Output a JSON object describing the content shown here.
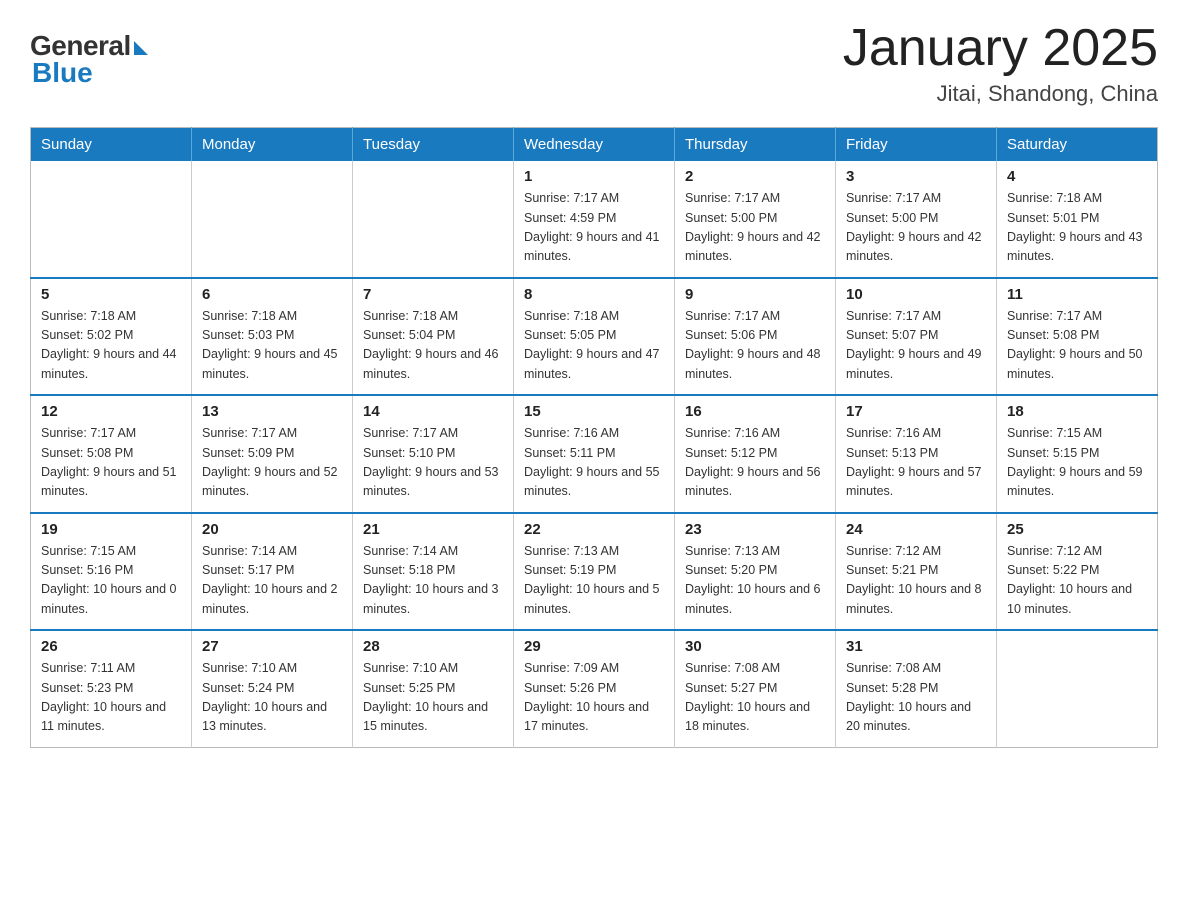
{
  "header": {
    "logo_general": "General",
    "logo_blue": "Blue",
    "month_title": "January 2025",
    "location": "Jitai, Shandong, China"
  },
  "weekdays": [
    "Sunday",
    "Monday",
    "Tuesday",
    "Wednesday",
    "Thursday",
    "Friday",
    "Saturday"
  ],
  "weeks": [
    [
      {
        "day": "",
        "info": ""
      },
      {
        "day": "",
        "info": ""
      },
      {
        "day": "",
        "info": ""
      },
      {
        "day": "1",
        "info": "Sunrise: 7:17 AM\nSunset: 4:59 PM\nDaylight: 9 hours\nand 41 minutes."
      },
      {
        "day": "2",
        "info": "Sunrise: 7:17 AM\nSunset: 5:00 PM\nDaylight: 9 hours\nand 42 minutes."
      },
      {
        "day": "3",
        "info": "Sunrise: 7:17 AM\nSunset: 5:00 PM\nDaylight: 9 hours\nand 42 minutes."
      },
      {
        "day": "4",
        "info": "Sunrise: 7:18 AM\nSunset: 5:01 PM\nDaylight: 9 hours\nand 43 minutes."
      }
    ],
    [
      {
        "day": "5",
        "info": "Sunrise: 7:18 AM\nSunset: 5:02 PM\nDaylight: 9 hours\nand 44 minutes."
      },
      {
        "day": "6",
        "info": "Sunrise: 7:18 AM\nSunset: 5:03 PM\nDaylight: 9 hours\nand 45 minutes."
      },
      {
        "day": "7",
        "info": "Sunrise: 7:18 AM\nSunset: 5:04 PM\nDaylight: 9 hours\nand 46 minutes."
      },
      {
        "day": "8",
        "info": "Sunrise: 7:18 AM\nSunset: 5:05 PM\nDaylight: 9 hours\nand 47 minutes."
      },
      {
        "day": "9",
        "info": "Sunrise: 7:17 AM\nSunset: 5:06 PM\nDaylight: 9 hours\nand 48 minutes."
      },
      {
        "day": "10",
        "info": "Sunrise: 7:17 AM\nSunset: 5:07 PM\nDaylight: 9 hours\nand 49 minutes."
      },
      {
        "day": "11",
        "info": "Sunrise: 7:17 AM\nSunset: 5:08 PM\nDaylight: 9 hours\nand 50 minutes."
      }
    ],
    [
      {
        "day": "12",
        "info": "Sunrise: 7:17 AM\nSunset: 5:08 PM\nDaylight: 9 hours\nand 51 minutes."
      },
      {
        "day": "13",
        "info": "Sunrise: 7:17 AM\nSunset: 5:09 PM\nDaylight: 9 hours\nand 52 minutes."
      },
      {
        "day": "14",
        "info": "Sunrise: 7:17 AM\nSunset: 5:10 PM\nDaylight: 9 hours\nand 53 minutes."
      },
      {
        "day": "15",
        "info": "Sunrise: 7:16 AM\nSunset: 5:11 PM\nDaylight: 9 hours\nand 55 minutes."
      },
      {
        "day": "16",
        "info": "Sunrise: 7:16 AM\nSunset: 5:12 PM\nDaylight: 9 hours\nand 56 minutes."
      },
      {
        "day": "17",
        "info": "Sunrise: 7:16 AM\nSunset: 5:13 PM\nDaylight: 9 hours\nand 57 minutes."
      },
      {
        "day": "18",
        "info": "Sunrise: 7:15 AM\nSunset: 5:15 PM\nDaylight: 9 hours\nand 59 minutes."
      }
    ],
    [
      {
        "day": "19",
        "info": "Sunrise: 7:15 AM\nSunset: 5:16 PM\nDaylight: 10 hours\nand 0 minutes."
      },
      {
        "day": "20",
        "info": "Sunrise: 7:14 AM\nSunset: 5:17 PM\nDaylight: 10 hours\nand 2 minutes."
      },
      {
        "day": "21",
        "info": "Sunrise: 7:14 AM\nSunset: 5:18 PM\nDaylight: 10 hours\nand 3 minutes."
      },
      {
        "day": "22",
        "info": "Sunrise: 7:13 AM\nSunset: 5:19 PM\nDaylight: 10 hours\nand 5 minutes."
      },
      {
        "day": "23",
        "info": "Sunrise: 7:13 AM\nSunset: 5:20 PM\nDaylight: 10 hours\nand 6 minutes."
      },
      {
        "day": "24",
        "info": "Sunrise: 7:12 AM\nSunset: 5:21 PM\nDaylight: 10 hours\nand 8 minutes."
      },
      {
        "day": "25",
        "info": "Sunrise: 7:12 AM\nSunset: 5:22 PM\nDaylight: 10 hours\nand 10 minutes."
      }
    ],
    [
      {
        "day": "26",
        "info": "Sunrise: 7:11 AM\nSunset: 5:23 PM\nDaylight: 10 hours\nand 11 minutes."
      },
      {
        "day": "27",
        "info": "Sunrise: 7:10 AM\nSunset: 5:24 PM\nDaylight: 10 hours\nand 13 minutes."
      },
      {
        "day": "28",
        "info": "Sunrise: 7:10 AM\nSunset: 5:25 PM\nDaylight: 10 hours\nand 15 minutes."
      },
      {
        "day": "29",
        "info": "Sunrise: 7:09 AM\nSunset: 5:26 PM\nDaylight: 10 hours\nand 17 minutes."
      },
      {
        "day": "30",
        "info": "Sunrise: 7:08 AM\nSunset: 5:27 PM\nDaylight: 10 hours\nand 18 minutes."
      },
      {
        "day": "31",
        "info": "Sunrise: 7:08 AM\nSunset: 5:28 PM\nDaylight: 10 hours\nand 20 minutes."
      },
      {
        "day": "",
        "info": ""
      }
    ]
  ]
}
